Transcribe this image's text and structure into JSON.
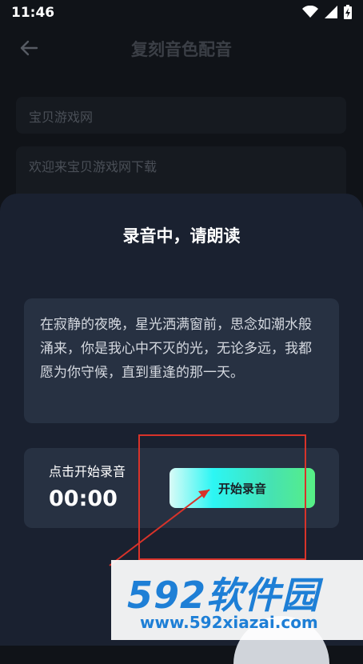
{
  "status_bar": {
    "time": "11:46"
  },
  "header": {
    "title": "复刻音色配音"
  },
  "background_fields": {
    "name_value": "宝贝游戏网",
    "text_value": "欢迎来宝贝游戏网下载"
  },
  "sheet": {
    "title": "录音中，请朗读",
    "read_text": "在寂静的夜晚，星光洒满窗前，思念如潮水般涌来，你是我心中不灭的光，无论多远，我都愿为你守候，直到重逢的那一天。",
    "record_hint": "点击开始录音",
    "timer": "00:00",
    "start_button_label": "开始录音"
  },
  "watermark": {
    "logo_text": "592软件园",
    "url": "www.592xiazai.com"
  },
  "colors": {
    "background": "#101318",
    "sheet": "#1a2130",
    "card": "#273142",
    "annotation": "#d8332a",
    "watermark_blue": "#1e7fd6"
  },
  "icons": [
    "back-arrow-icon",
    "wifi-icon",
    "signal-icon",
    "battery-icon"
  ]
}
